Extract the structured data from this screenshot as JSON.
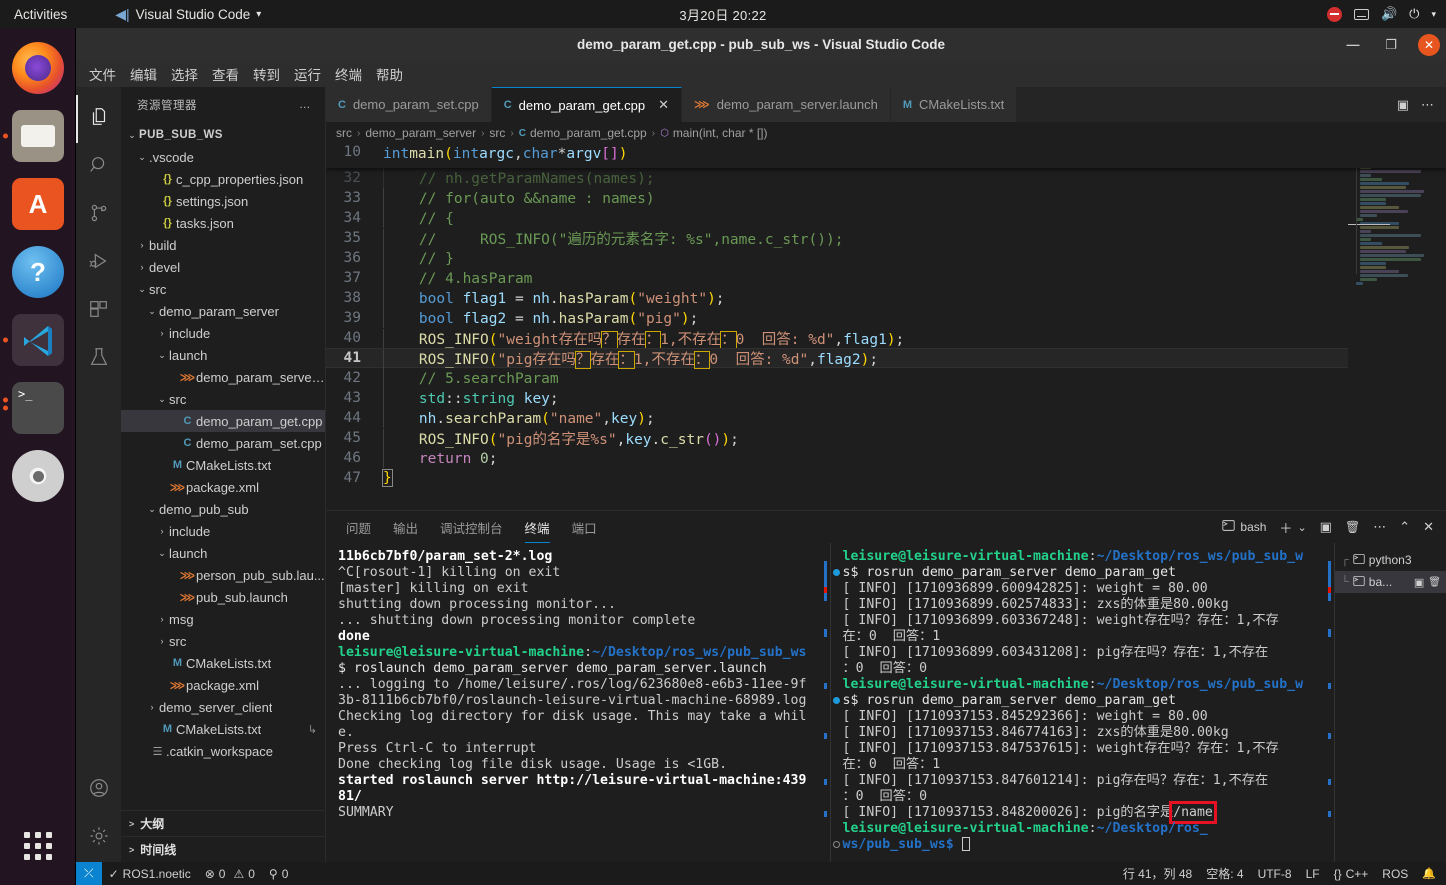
{
  "gnome": {
    "activities": "Activities",
    "app_menu": "Visual Studio Code",
    "app_menu_caret": "▾",
    "clock": "3月20日  20:22",
    "tray": {
      "dnd": "do-not-disturb-icon",
      "keyboard": "keyboard-icon",
      "volume": "🔊",
      "power": "⏻",
      "caret": "▾"
    }
  },
  "dock": {
    "items": [
      {
        "name": "firefox",
        "label": "Firefox",
        "running": false
      },
      {
        "name": "files",
        "label": "Files",
        "running": true
      },
      {
        "name": "ubuntu-software",
        "label": "Ubuntu Software",
        "running": false
      },
      {
        "name": "help",
        "label": "Help",
        "running": false
      },
      {
        "name": "visual-studio-code",
        "label": "Visual Studio Code",
        "running": true,
        "active": true
      },
      {
        "name": "terminal",
        "label": "Terminal",
        "running": true,
        "running_count": 2
      },
      {
        "name": "dvd",
        "label": "DVD",
        "running": false
      }
    ],
    "show_apps": "Show Applications"
  },
  "window": {
    "title": "demo_param_get.cpp - pub_sub_ws - Visual Studio Code",
    "minimize": "—",
    "maximize": "❐",
    "close": "✕"
  },
  "menubar": [
    "文件",
    "编辑",
    "选择",
    "查看",
    "转到",
    "运行",
    "终端",
    "帮助"
  ],
  "activitybar": [
    {
      "name": "explorer",
      "icon": "files-icon",
      "active": true
    },
    {
      "name": "search",
      "icon": "search-icon",
      "active": false
    },
    {
      "name": "source-control",
      "icon": "source-control-icon",
      "active": false
    },
    {
      "name": "run-and-debug",
      "icon": "debug-icon",
      "active": false
    },
    {
      "name": "extensions",
      "icon": "extensions-icon",
      "active": false
    },
    {
      "name": "testing",
      "icon": "beaker-icon",
      "active": false
    }
  ],
  "activitybar_bottom": [
    {
      "name": "accounts",
      "icon": "account-icon"
    },
    {
      "name": "settings",
      "icon": "gear-icon"
    }
  ],
  "sidebar": {
    "title": "资源管理器",
    "more": "…",
    "tree": [
      {
        "indent": 0,
        "twisty": "v",
        "icon": "",
        "label": "PUB_SUB_WS",
        "root": true
      },
      {
        "indent": 1,
        "twisty": "v",
        "icon": "",
        "label": ".vscode"
      },
      {
        "indent": 2,
        "twisty": "",
        "icon": "{}",
        "iconcls": "ic-json",
        "label": "c_cpp_properties.json"
      },
      {
        "indent": 2,
        "twisty": "",
        "icon": "{}",
        "iconcls": "ic-json",
        "label": "settings.json"
      },
      {
        "indent": 2,
        "twisty": "",
        "icon": "{}",
        "iconcls": "ic-json",
        "label": "tasks.json"
      },
      {
        "indent": 1,
        "twisty": ">",
        "icon": "",
        "label": "build"
      },
      {
        "indent": 1,
        "twisty": ">",
        "icon": "",
        "label": "devel"
      },
      {
        "indent": 1,
        "twisty": "v",
        "icon": "",
        "label": "src"
      },
      {
        "indent": 2,
        "twisty": "v",
        "icon": "",
        "label": "demo_param_server"
      },
      {
        "indent": 3,
        "twisty": ">",
        "icon": "",
        "label": "include"
      },
      {
        "indent": 3,
        "twisty": "v",
        "icon": "",
        "label": "launch"
      },
      {
        "indent": 4,
        "twisty": "",
        "icon": "⋙",
        "iconcls": "ic-xml",
        "label": "demo_param_server..."
      },
      {
        "indent": 3,
        "twisty": "v",
        "icon": "",
        "label": "src"
      },
      {
        "indent": 4,
        "twisty": "",
        "icon": "C",
        "iconcls": "ic-cpp",
        "label": "demo_param_get.cpp",
        "selected": true
      },
      {
        "indent": 4,
        "twisty": "",
        "icon": "C",
        "iconcls": "ic-cpp",
        "label": "demo_param_set.cpp"
      },
      {
        "indent": 3,
        "twisty": "",
        "icon": "M",
        "iconcls": "ic-md",
        "label": "CMakeLists.txt"
      },
      {
        "indent": 3,
        "twisty": "",
        "icon": "⋙",
        "iconcls": "ic-xml",
        "label": "package.xml"
      },
      {
        "indent": 2,
        "twisty": "v",
        "icon": "",
        "label": "demo_pub_sub"
      },
      {
        "indent": 3,
        "twisty": ">",
        "icon": "",
        "label": "include"
      },
      {
        "indent": 3,
        "twisty": "v",
        "icon": "",
        "label": "launch"
      },
      {
        "indent": 4,
        "twisty": "",
        "icon": "⋙",
        "iconcls": "ic-xml",
        "label": "person_pub_sub.lau..."
      },
      {
        "indent": 4,
        "twisty": "",
        "icon": "⋙",
        "iconcls": "ic-xml",
        "label": "pub_sub.launch"
      },
      {
        "indent": 3,
        "twisty": ">",
        "icon": "",
        "label": "msg"
      },
      {
        "indent": 3,
        "twisty": ">",
        "icon": "",
        "label": "src"
      },
      {
        "indent": 3,
        "twisty": "",
        "icon": "M",
        "iconcls": "ic-md",
        "label": "CMakeLists.txt"
      },
      {
        "indent": 3,
        "twisty": "",
        "icon": "⋙",
        "iconcls": "ic-xml",
        "label": "package.xml"
      },
      {
        "indent": 2,
        "twisty": ">",
        "icon": "",
        "label": "demo_server_client"
      },
      {
        "indent": 2,
        "twisty": "",
        "icon": "M",
        "iconcls": "ic-md",
        "label": "CMakeLists.txt",
        "trailing": "↳"
      },
      {
        "indent": 1,
        "twisty": "",
        "icon": "☰",
        "iconcls": "ic-txt",
        "label": ".catkin_workspace"
      }
    ],
    "sections": [
      {
        "twisty": ">",
        "label": "大纲"
      },
      {
        "twisty": ">",
        "label": "时间线"
      }
    ]
  },
  "tabs": [
    {
      "label": "demo_param_set.cpp",
      "icon": "cpp-icon",
      "active": false,
      "closable": false
    },
    {
      "label": "demo_param_get.cpp",
      "icon": "cpp-icon",
      "active": true,
      "closable": true,
      "close": "✕"
    },
    {
      "label": "demo_param_server.launch",
      "icon": "xml-icon",
      "active": false,
      "closable": false
    },
    {
      "label": "CMakeLists.txt",
      "icon": "md-icon",
      "active": false,
      "closable": false
    }
  ],
  "tabs_actions": {
    "split": "▣",
    "more": "⋯"
  },
  "breadcrumb": [
    {
      "label": "src",
      "icon": ""
    },
    {
      "label": "demo_param_server",
      "icon": ""
    },
    {
      "label": "src",
      "icon": ""
    },
    {
      "label": "demo_param_get.cpp",
      "icon": "cpp-icon"
    },
    {
      "label": "main(int, char * [])",
      "icon": "symbol-method-icon"
    }
  ],
  "breadcrumb_sep": "›",
  "editor": {
    "sticky_line_number": "10",
    "sticky_text": "int main(int argc, char *argv[])",
    "current_line": 41,
    "lines": [
      {
        "n": 32,
        "text": "    // nh.getParamNames(names);"
      },
      {
        "n": 33,
        "text": "    // for(auto &&name : names)"
      },
      {
        "n": 34,
        "text": "    // {"
      },
      {
        "n": 35,
        "text": "    //     ROS_INFO(\"遍历的元素名字: %s\",name.c_str());"
      },
      {
        "n": 36,
        "text": "    // }"
      },
      {
        "n": 37,
        "text": "    // 4.hasParam"
      },
      {
        "n": 38,
        "text": "    bool flag1 = nh.hasParam(\"weight\");"
      },
      {
        "n": 39,
        "text": "    bool flag2 = nh.hasParam(\"pig\");"
      },
      {
        "n": 40,
        "text": "    ROS_INFO(\"weight存在吗？存在：1,不存在：0  回答: %d\",flag1);"
      },
      {
        "n": 41,
        "text": "    ROS_INFO(\"pig存在吗？存在：1,不存在：0  回答: %d\",flag2);"
      },
      {
        "n": 42,
        "text": "    // 5.searchParam"
      },
      {
        "n": 43,
        "text": "    std::string key;"
      },
      {
        "n": 44,
        "text": "    nh.searchParam(\"name\",key);"
      },
      {
        "n": 45,
        "text": "    ROS_INFO(\"pig的名字是%s\",key.c_str());"
      },
      {
        "n": 46,
        "text": "    return 0;"
      },
      {
        "n": 47,
        "text": "}"
      }
    ]
  },
  "panel": {
    "tabs": [
      {
        "label": "问题",
        "active": false
      },
      {
        "label": "输出",
        "active": false
      },
      {
        "label": "调试控制台",
        "active": false
      },
      {
        "label": "终端",
        "active": true
      },
      {
        "label": "端口",
        "active": false
      }
    ],
    "actions": {
      "shell_label": "bash",
      "new_terminal": "＋",
      "dropdown": "⌄",
      "split": "▣",
      "kill": "🗑",
      "more": "⋯",
      "maximize": "⌃",
      "close": "✕"
    },
    "terminal_left": [
      {
        "text": "11b6cb7bf0/param_set-2*.log",
        "cls": "bold"
      },
      {
        "text": "^C[rosout-1] killing on exit",
        "cls": ""
      },
      {
        "text": "[master] killing on exit",
        "cls": ""
      },
      {
        "text": "shutting down processing monitor...",
        "cls": ""
      },
      {
        "text": "... shutting down processing monitor complete",
        "cls": ""
      },
      {
        "text": "done",
        "cls": "bold"
      },
      {
        "text": "leisure@leisure-virtual-machine:~/Desktop/ros_ws/pub_sub_ws",
        "cls": "prompt"
      },
      {
        "text": "$ roslaunch demo_param_server demo_param_server.launch",
        "cls": "cmd"
      },
      {
        "text": "... logging to /home/leisure/.ros/log/623680e8-e6b3-11ee-9f",
        "cls": ""
      },
      {
        "text": "3b-8111b6cb7bf0/roslaunch-leisure-virtual-machine-68989.log",
        "cls": ""
      },
      {
        "text": "Checking log directory for disk usage. This may take a whil",
        "cls": ""
      },
      {
        "text": "e.",
        "cls": ""
      },
      {
        "text": "Press Ctrl-C to interrupt",
        "cls": ""
      },
      {
        "text": "Done checking log file disk usage. Usage is <1GB.",
        "cls": ""
      },
      {
        "text": "",
        "cls": ""
      },
      {
        "text": "started roslaunch server http://leisure-virtual-machine:439",
        "cls": "bold"
      },
      {
        "text": "81/",
        "cls": "bold"
      },
      {
        "text": "",
        "cls": ""
      },
      {
        "text": "SUMMARY",
        "cls": ""
      }
    ],
    "terminal_right": [
      {
        "text": "leisure@leisure-virtual-machine:~/Desktop/ros_ws/pub_sub_w",
        "cls": "prompt"
      },
      {
        "text": "s$ rosrun demo_param_server demo_param_get",
        "cls": "cmd",
        "dot": "ok"
      },
      {
        "text": "[ INFO] [1710936899.600942825]: weight = 80.00",
        "cls": ""
      },
      {
        "text": "[ INFO] [1710936899.602574833]: zxs的体重是80.00kg",
        "cls": ""
      },
      {
        "text": "[ INFO] [1710936899.603367248]: weight存在吗？存在：1,不存",
        "cls": ""
      },
      {
        "text": "在：0  回答：1",
        "cls": ""
      },
      {
        "text": "[ INFO] [1710936899.603431208]: pig存在吗？存在：1,不存在",
        "cls": ""
      },
      {
        "text": "：0  回答：0",
        "cls": ""
      },
      {
        "text": "leisure@leisure-virtual-machine:~/Desktop/ros_ws/pub_sub_w",
        "cls": "prompt"
      },
      {
        "text": "s$ rosrun demo_param_server demo_param_get",
        "cls": "cmd",
        "dot": "ok"
      },
      {
        "text": "[ INFO] [1710937153.845292366]: weight = 80.00",
        "cls": ""
      },
      {
        "text": "[ INFO] [1710937153.846774163]: zxs的体重是80.00kg",
        "cls": ""
      },
      {
        "text": "[ INFO] [1710937153.847537615]: weight存在吗？存在：1,不存",
        "cls": ""
      },
      {
        "text": "在：0  回答：1",
        "cls": ""
      },
      {
        "text": "[ INFO] [1710937153.847601214]: pig存在吗？存在：1,不存在",
        "cls": ""
      },
      {
        "text": "：0  回答：0",
        "cls": ""
      },
      {
        "text": "[ INFO] [1710937153.848200026]: pig的名字是",
        "cls": "",
        "highlight": "/name"
      },
      {
        "text": "leisure@leisure-virtual-machine:~/Desktop/ros_",
        "cls": "prompt"
      },
      {
        "text": "ws/pub_sub_ws$ ",
        "cls": "prompt-tail",
        "dot": "hollow",
        "cursor": true
      }
    ],
    "terminal_list": [
      {
        "label": "python3",
        "tree": "┌",
        "selected": false
      },
      {
        "label": "ba...",
        "tree": "└",
        "selected": true,
        "split": "▣",
        "kill": "🗑"
      }
    ]
  },
  "statusbar": {
    "remote": "⤫",
    "ros_check": "✓",
    "ros": "ROS1.noetic",
    "errors_icon": "⊗",
    "errors": "0",
    "warnings_icon": "⚠",
    "warnings": "0",
    "radio_icon": "⚲",
    "radio": "0",
    "cursor": "行 41，列 48",
    "spaces": "空格: 4",
    "encoding": "UTF-8",
    "eol": "LF",
    "lang_icon": "{}",
    "language": "C++",
    "ros_status": "ROS",
    "bell": "🔔"
  },
  "colors": {
    "accent": "#0a84d1",
    "ubuntu_orange": "#e95420",
    "terminal_green": "#23d18b",
    "terminal_blue": "#2472c8",
    "highlight_red": "#e81123",
    "unicode_warn": "#cca700"
  }
}
